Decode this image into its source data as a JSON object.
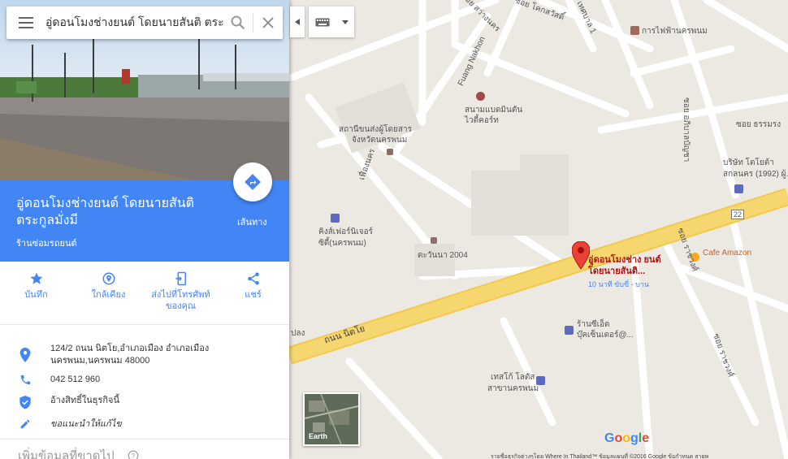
{
  "search": {
    "query": "อู่ดอนโมงช่างยนต์ โดยนายสันติ ตระ"
  },
  "place": {
    "title": "อู่ดอนโมงช่างยนต์ โดยนายสันติ ตระกูลมั่งมี",
    "category": "ร้านซ่อมรถยนต์",
    "directions_label": "เส้นทาง"
  },
  "actions": [
    {
      "label": "บันทึก",
      "icon": "star-icon"
    },
    {
      "label": "ใกล้เคียง",
      "icon": "nearby-icon"
    },
    {
      "label": "ส่งไปที่โทรศัพท์ของคุณ",
      "icon": "send-to-phone-icon"
    },
    {
      "label": "แชร์",
      "icon": "share-icon"
    }
  ],
  "info": {
    "address": "124/2 ถนน นิตโย,อำเภอเมือง อำเภอเมืองนครพนม,นครพนม 48000",
    "phone": "042 512 960",
    "claim": "อ้างสิทธิ์ในธุรกิจนี้",
    "suggest": "ขอแนะนำให้แก้ไข"
  },
  "more": {
    "label": "เพิ่มข้อมูลที่ขาดไป"
  },
  "map": {
    "labels": {
      "soi_1": "ซอย สว่างนคร",
      "soi_2": "ซอย โคกสวัสดิ์",
      "soi_3": "เทศบาล 1",
      "electric": "การไฟฟ้านครพนม",
      "fuang": "Fuang Nakhon",
      "badminton_1": "สนามแบดมินตัน",
      "badminton_2": "ไวตี้คอร์ท",
      "transport_1": "สถานีขนส่งผู้โดยสาร",
      "transport_2": "จังหวัดนครพนม",
      "soi_4": "ซอย อภิบาลบัญชา",
      "soi_5": "ซอย ธรรมรง",
      "toyota_1": "บริษัท โตโยต้า",
      "toyota_2": "สกลนคร (1992) ผู้...",
      "road_22": "22",
      "cafe": "Cafe Amazon",
      "kings_1": "คิงส์เฟอร์นิเจอร์",
      "kings_2": "ซิตี้(นครพนม)",
      "tawanna": "ตะวันนา 2004",
      "phueng": "เฟื่องนคร",
      "soi_6": "ซอย ราชวงศ์",
      "soi_7": "ซอย ราชวงศ์",
      "com_1": "ร้านซีเอ็ด",
      "com_2": "บุ๊คเซ็นเตอร์@...",
      "nittayo": "ถนน นิตโย",
      "plong": "ปลง",
      "tesco_1": "เทสโก้ โลตัส",
      "tesco_2": "สาขานครพนม"
    },
    "pin_title": "อู่ดอนโมงช่าง ยนต์ โดยนายสันติ...",
    "pin_sub": "10 นาที ขับขี่ - บาน",
    "earth_label": "Earth",
    "google": "Google",
    "attribution": "รายชื่อธุรกิจต่างๆโดย Where In Thailand™   ข้อมูลแผนที่ ©2016 Google   ข้อกำหนด   สายพ"
  }
}
